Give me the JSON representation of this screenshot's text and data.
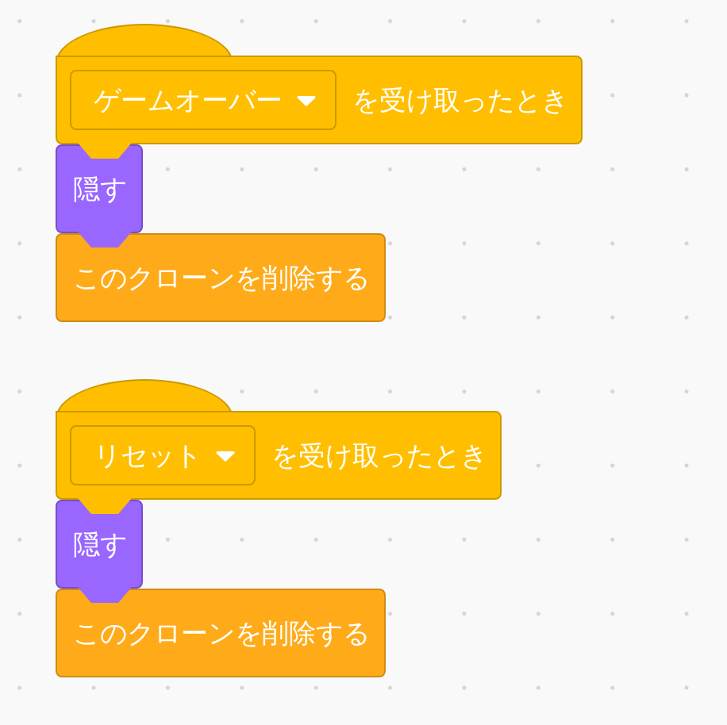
{
  "scripts": [
    {
      "blocks": [
        {
          "kind": "hat",
          "dropdown": "ゲームオーバー",
          "text": "を受け取ったとき"
        },
        {
          "kind": "looks",
          "text": "隠す"
        },
        {
          "kind": "control",
          "text": "このクローンを削除する"
        }
      ]
    },
    {
      "blocks": [
        {
          "kind": "hat",
          "dropdown": "リセット",
          "text": "を受け取ったとき"
        },
        {
          "kind": "looks",
          "text": "隠す"
        },
        {
          "kind": "control",
          "text": "このクローンを削除する"
        }
      ]
    }
  ]
}
